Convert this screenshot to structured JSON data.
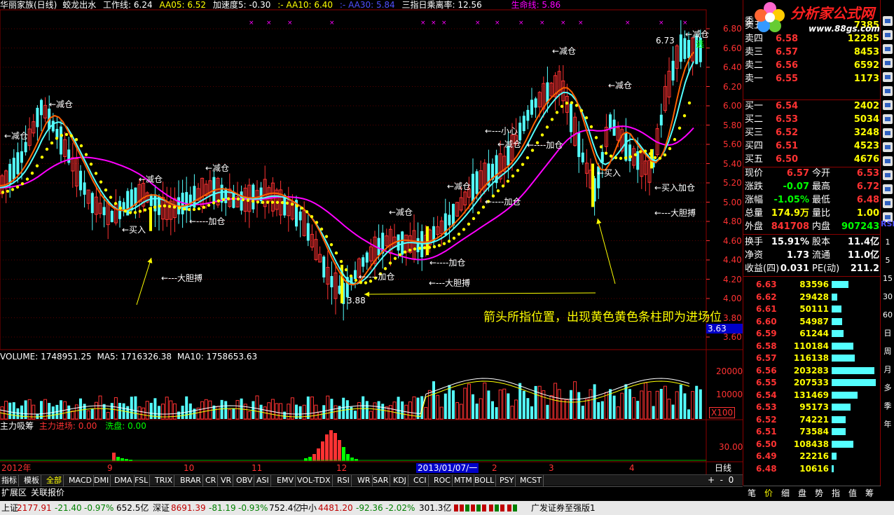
{
  "header": {
    "stock_name": "华丽家族(日线)",
    "formula_name": "蛟龙出水",
    "work_line": "工作线: 6.24",
    "aa05": "AA05: 6.52",
    "speed": "加速度5: -0.30",
    "aa10_label": ":-  AA10: 6.40",
    "aa30_label": ":-  AA30: 5.84",
    "tri_label": "三指日乘离率: 12.56",
    "life_line": "生命线: 5.86"
  },
  "price_axis": [
    "6.80",
    "6.60",
    "6.40",
    "6.20",
    "6.00",
    "5.80",
    "5.60",
    "5.40",
    "5.20",
    "5.00",
    "4.80",
    "4.60",
    "4.40",
    "4.20",
    "4.00",
    "3.80",
    "3.60"
  ],
  "current_price_tag": "3.63",
  "annotations": {
    "jiancang": "←减仓",
    "jiacang": "←----加仓",
    "mairu": "←买入",
    "dadan": "←---大胆搏",
    "xiaoxin": "←---小心",
    "mairujiacang": "←买入加仓",
    "low_price": "3.88",
    "high_price": "6.73",
    "tao": "逃",
    "note": "箭头所指位置，出现黄色黄色条柱即为进场位"
  },
  "volume_header": {
    "volume": "VOLUME: 1748951.25",
    "ma5": "MA5: 1716326.38",
    "ma10": "MA10: 1758653.63"
  },
  "volume_axis": [
    "20000",
    "10000",
    "X100"
  ],
  "indicator_header": {
    "name": "主力吸筹",
    "enter": "主力进场: 0.00",
    "wash": "洗盘: 0.00"
  },
  "indicator_axis": [
    "30.00"
  ],
  "x_axis": [
    "2012年",
    "9",
    "10",
    "11",
    "12",
    "2013/01/07/一",
    "2",
    "3",
    "4"
  ],
  "period_label": "日线",
  "toolbar_items": [
    "指标",
    "模板",
    "全部",
    "MACD",
    "DMI",
    "DMA",
    "FSL",
    "TRIX",
    "BRAR",
    "CR",
    "VR",
    "OBV",
    "ASI",
    "EMV",
    "VOL-TDX",
    "RSI",
    "WR",
    "SAR",
    "KDJ",
    "CCI",
    "ROC",
    "MTM",
    "BOLL",
    "PSY",
    "MCST"
  ],
  "bottom_tabs": [
    "扩展区",
    "关联报价"
  ],
  "quote_panel": {
    "wei_label": "委",
    "asks": [
      {
        "label": "卖五",
        "price": "",
        "vol": "7385"
      },
      {
        "label": "卖四",
        "price": "6.58",
        "vol": "12285"
      },
      {
        "label": "卖三",
        "price": "6.57",
        "vol": "8453"
      },
      {
        "label": "卖二",
        "price": "6.56",
        "vol": "6592"
      },
      {
        "label": "卖一",
        "price": "6.55",
        "vol": "1173"
      }
    ],
    "bids": [
      {
        "label": "买一",
        "price": "6.54",
        "vol": "2402"
      },
      {
        "label": "买二",
        "price": "6.53",
        "vol": "5034"
      },
      {
        "label": "买三",
        "price": "6.52",
        "vol": "3248"
      },
      {
        "label": "买四",
        "price": "6.51",
        "vol": "4523"
      },
      {
        "label": "买五",
        "price": "6.50",
        "vol": "4676"
      }
    ],
    "stats": [
      {
        "l1": "现价",
        "v1": "6.57",
        "l2": "今开",
        "v2": "6.53"
      },
      {
        "l1": "涨跌",
        "v1": "-0.07",
        "l2": "最高",
        "v2": "6.72"
      },
      {
        "l1": "涨幅",
        "v1": "-1.05%",
        "l2": "最低",
        "v2": "6.48"
      },
      {
        "l1": "总量",
        "v1": "174.9万",
        "l2": "量比",
        "v2": "1.00"
      },
      {
        "l1": "外盘",
        "v1": "841708",
        "l2": "内盘",
        "v2": "907243"
      },
      {
        "l1": "换手",
        "v1": "15.91%",
        "l2": "股本",
        "v2": "11.4亿"
      },
      {
        "l1": "净资",
        "v1": "1.73",
        "l2": "流通",
        "v2": "11.0亿"
      },
      {
        "l1": "收益(四)",
        "v1": "0.031",
        "l2": "PE(动)",
        "v2": "211.2"
      }
    ],
    "depth": [
      {
        "price": "6.63",
        "vol": "83596",
        "frac": 0.35
      },
      {
        "price": "6.62",
        "vol": "29428",
        "frac": 0.12
      },
      {
        "price": "6.61",
        "vol": "50111",
        "frac": 0.2
      },
      {
        "price": "6.60",
        "vol": "54987",
        "frac": 0.22
      },
      {
        "price": "6.59",
        "vol": "61244",
        "frac": 0.25
      },
      {
        "price": "6.58",
        "vol": "110184",
        "frac": 0.45
      },
      {
        "price": "6.57",
        "vol": "116138",
        "frac": 0.48
      },
      {
        "price": "6.56",
        "vol": "203283",
        "frac": 0.9
      },
      {
        "price": "6.55",
        "vol": "207533",
        "frac": 0.92
      },
      {
        "price": "6.54",
        "vol": "131469",
        "frac": 0.55
      },
      {
        "price": "6.53",
        "vol": "95173",
        "frac": 0.4
      },
      {
        "price": "6.52",
        "vol": "74221",
        "frac": 0.3
      },
      {
        "price": "6.51",
        "vol": "73584",
        "frac": 0.3
      },
      {
        "price": "6.50",
        "vol": "108438",
        "frac": 0.45
      },
      {
        "price": "6.49",
        "vol": "22216",
        "frac": 0.1
      },
      {
        "price": "6.48",
        "vol": "10616",
        "frac": 0.05
      }
    ],
    "bottom_tabs": [
      "笔",
      "价",
      "细",
      "盘",
      "势",
      "指",
      "值",
      "筹"
    ]
  },
  "logo": {
    "title": "分析家公式网",
    "url": "www.88gs.com"
  },
  "side_tabs": [
    "RSI",
    "1",
    "5",
    "15",
    "30",
    "60",
    "日",
    "周",
    "月",
    "多",
    "季",
    "年"
  ],
  "status_bar": {
    "sh_label": "上证",
    "sh_value": "2177.91",
    "sh_change": "-21.40",
    "sh_pct": "-0.97%",
    "sh_amount": "652.5亿",
    "sz_label": "深证",
    "sz_value": "8691.39",
    "sz_change": "-81.19",
    "sz_pct": "-0.93%",
    "sz_amount": "752.4亿",
    "zx_label": "中小",
    "zx_value": "4481.20",
    "zx_change": "-92.36",
    "zx_pct": "-2.02%",
    "zx_amount": "301.3亿",
    "broker": "广发证券至强版1"
  },
  "colors": {
    "up": "#ff3232",
    "down": "#54ffff",
    "yellow": "#ffff00",
    "magenta": "#ff00ff",
    "orange": "#ff8000"
  }
}
